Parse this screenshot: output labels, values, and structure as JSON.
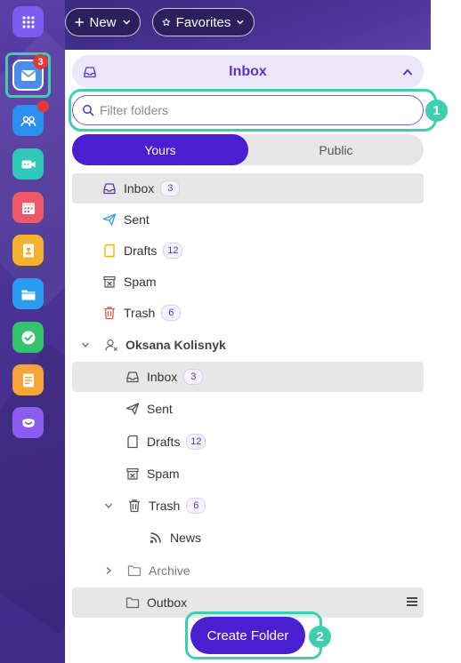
{
  "app_rail": {
    "mail_badge": "3",
    "apps": [
      {
        "name": "apps-grid-icon",
        "color": "#7a5cf0"
      },
      {
        "name": "mail-icon",
        "color": "#4a8df0"
      },
      {
        "name": "contacts-icon",
        "color": "#2a8ff0"
      },
      {
        "name": "video-call-icon",
        "color": "#30c8b8"
      },
      {
        "name": "calendar-icon",
        "color": "#ef5a6a"
      },
      {
        "name": "address-book-icon",
        "color": "#f3b331"
      },
      {
        "name": "files-icon",
        "color": "#2a9df0"
      },
      {
        "name": "tasks-icon",
        "color": "#34c36a"
      },
      {
        "name": "notes-icon",
        "color": "#f5a33a"
      },
      {
        "name": "brand-icon",
        "color": "#8a5cf0"
      }
    ]
  },
  "toolbar": {
    "new_label": "New",
    "favorites_label": "Favorites"
  },
  "folder_header": {
    "title": "Inbox"
  },
  "filter": {
    "placeholder": "Filter folders"
  },
  "tabs": {
    "yours": "Yours",
    "public": "Public"
  },
  "folders": [
    {
      "label": "Inbox",
      "count": "3",
      "icon": "inbox-icon"
    },
    {
      "label": "Sent",
      "count": "",
      "icon": "sent-icon"
    },
    {
      "label": "Drafts",
      "count": "12",
      "icon": "drafts-icon"
    },
    {
      "label": "Spam",
      "count": "",
      "icon": "spam-icon"
    },
    {
      "label": "Trash",
      "count": "6",
      "icon": "trash-icon"
    }
  ],
  "account": {
    "name": "Oksana Kolisnyk",
    "folders": [
      {
        "label": "Inbox",
        "count": "3"
      },
      {
        "label": "Sent",
        "count": ""
      },
      {
        "label": "Drafts",
        "count": "12"
      },
      {
        "label": "Spam",
        "count": ""
      },
      {
        "label": "Trash",
        "count": "6"
      },
      {
        "label": "News",
        "count": ""
      },
      {
        "label": "Archive",
        "count": ""
      },
      {
        "label": "Outbox",
        "count": ""
      }
    ]
  },
  "callouts": {
    "one": "1",
    "two": "2"
  },
  "create_folder_label": "Create Folder",
  "colors": {
    "accent": "#4a1ed1",
    "highlight": "#3ecfb0",
    "badge": "#e53935"
  }
}
